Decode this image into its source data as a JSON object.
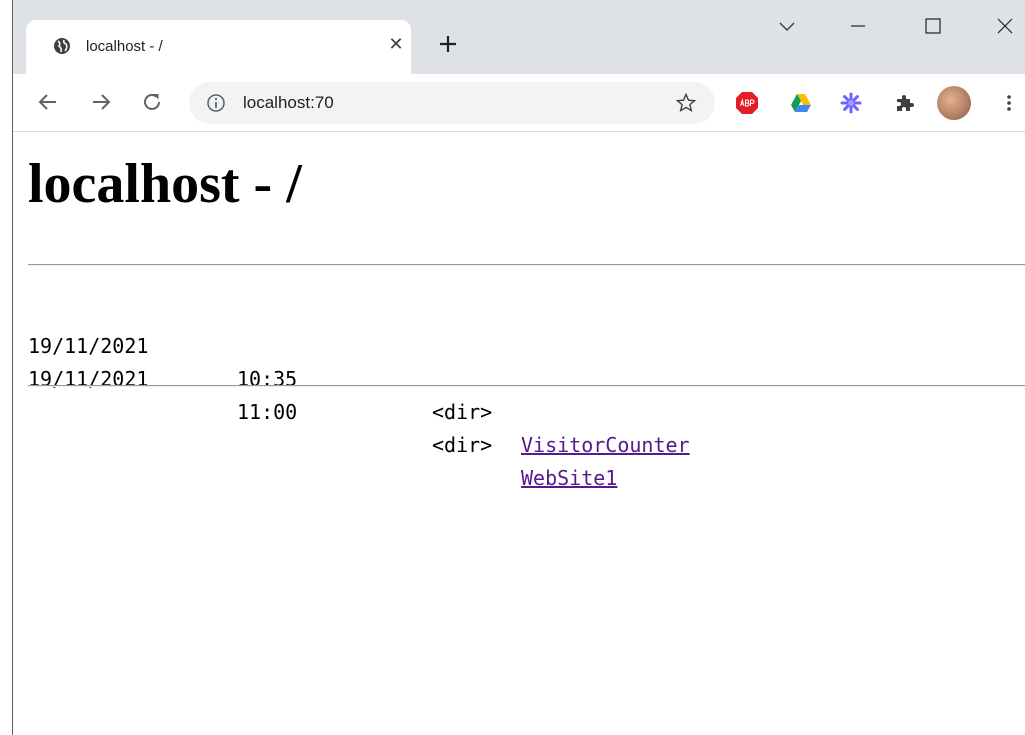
{
  "browser": {
    "tab": {
      "title": "localhost - /"
    },
    "omnibox": {
      "url": "localhost:70"
    }
  },
  "page": {
    "title": "localhost - /",
    "entries": [
      {
        "date": "19/11/2021",
        "time": "10:35",
        "type": "<dir>",
        "name": "VisitorCounter"
      },
      {
        "date": "19/11/2021",
        "time": "11:00",
        "type": "<dir>",
        "name": "WebSite1"
      }
    ]
  },
  "colors": {
    "tabstrip": "#dee1e6",
    "omnibox": "#f1f3f4",
    "visited_link": "#551a8b"
  }
}
